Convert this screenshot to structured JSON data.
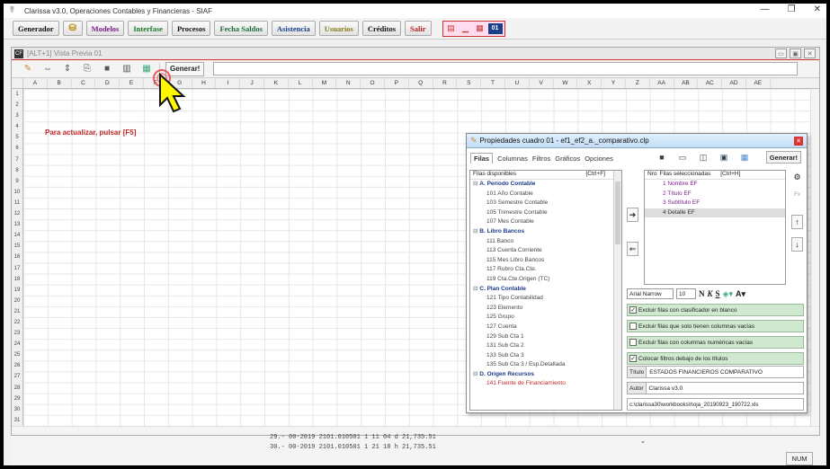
{
  "window": {
    "title": "Clarissa v3.0, Operaciones Contables y Financieras - SIAF"
  },
  "menu": {
    "generador": "Generador",
    "modelos": "Modelos",
    "interfase": "Interfase",
    "procesos": "Procesos",
    "fecha_saldos": "Fecha Saldos",
    "asistencia": "Asistencia",
    "usuarios": "Usuarios",
    "creditos": "Créditos",
    "salir": "Salir",
    "badge": "01"
  },
  "inner": {
    "title": "[ALT+1] Vista Previa 01",
    "generar": "Generar!"
  },
  "sheet": {
    "columns": [
      "A",
      "B",
      "C",
      "D",
      "E",
      "F",
      "G",
      "H",
      "I",
      "J",
      "K",
      "L",
      "M",
      "N",
      "O",
      "P",
      "Q",
      "R",
      "S",
      "T",
      "U",
      "V",
      "W",
      "X",
      "Y",
      "Z",
      "AA",
      "AB",
      "AC",
      "AD",
      "AE"
    ],
    "rows": [
      "1",
      "2",
      "3",
      "4",
      "5",
      "6",
      "7",
      "8",
      "9",
      "10",
      "11",
      "12",
      "13",
      "14",
      "15",
      "16",
      "17",
      "18",
      "19",
      "20",
      "21",
      "22",
      "23",
      "24",
      "25",
      "26",
      "27",
      "28",
      "29",
      "30",
      "31"
    ],
    "message": "Para actualizar, pulsar [F5]"
  },
  "dialog": {
    "title": "Propiedades cuadro 01 - ef1_ef2_a._comparativo.clp",
    "tabs": [
      "Filas",
      "Columnas",
      "Filtros",
      "Gráficos",
      "Opciones"
    ],
    "generar": "Generar!",
    "left_header": "Filas disponibles",
    "left_shortcut": "[Ctrl+F]",
    "left_items": [
      {
        "text": "A. Período Contable",
        "group": true
      },
      {
        "text": "101 Año Contable"
      },
      {
        "text": "103 Semestre Contable"
      },
      {
        "text": "105 Trimestre Contable"
      },
      {
        "text": "107 Mes Contable"
      },
      {
        "text": "B. Libro Bancos",
        "group": true
      },
      {
        "text": "111 Banco"
      },
      {
        "text": "113 Cuenta Corriente"
      },
      {
        "text": "115 Mes Libro Bancos"
      },
      {
        "text": "117 Rubro Cta.Cte."
      },
      {
        "text": "119 Cta.Cte.Origen (TC)"
      },
      {
        "text": "C. Plan Contable",
        "group": true
      },
      {
        "text": "121 Tipo Contabilidad"
      },
      {
        "text": "123 Elemento"
      },
      {
        "text": "125 Grupo"
      },
      {
        "text": "127 Cuenta"
      },
      {
        "text": "129 Sub Cta 1"
      },
      {
        "text": "131 Sub Cta 2"
      },
      {
        "text": "133 Sub Cta 3"
      },
      {
        "text": "135 Sub Cta 3 / Esp.Detallada"
      },
      {
        "text": "D. Origen Recursos",
        "group": true
      },
      {
        "text": "141 Fuente de Financiamiento"
      }
    ],
    "right_header_nro": "Nro",
    "right_header": "Filas seleccionadas",
    "right_shortcut": "[Ctrl+H]",
    "right_items": [
      "1 Nombre EF",
      "2 Título EF",
      "3 Subtítulo EF",
      "4 Detalle EF"
    ],
    "font_name": "Arial Narrow",
    "font_size": "10",
    "checks": [
      {
        "label": "Excluir filas con clasificador en blanco",
        "checked": true
      },
      {
        "label": "Excluir filas que solo tienen columnas vacías",
        "checked": false
      },
      {
        "label": "Excluir filas con columnas numéricas vacías",
        "checked": false
      },
      {
        "label": "Colocar filtros debajo de los títulos",
        "checked": true
      }
    ],
    "titulo_label": "Título",
    "titulo_value": "ESTADOS FINANCIEROS COMPARATIVO",
    "autor_label": "Autor",
    "autor_value": "Clarissa v3.0",
    "path": "c:\\clarissa30\\workbooks\\hoja_20190923_190722.xls"
  },
  "bottom": {
    "row_top": "29.-  00-2019  2101.010501  1 11 04  d      21,735.51",
    "row_bottom": "30.-  00-2019  2101.010501  1 21 18  h      21,735.51",
    "status": "NUM"
  }
}
